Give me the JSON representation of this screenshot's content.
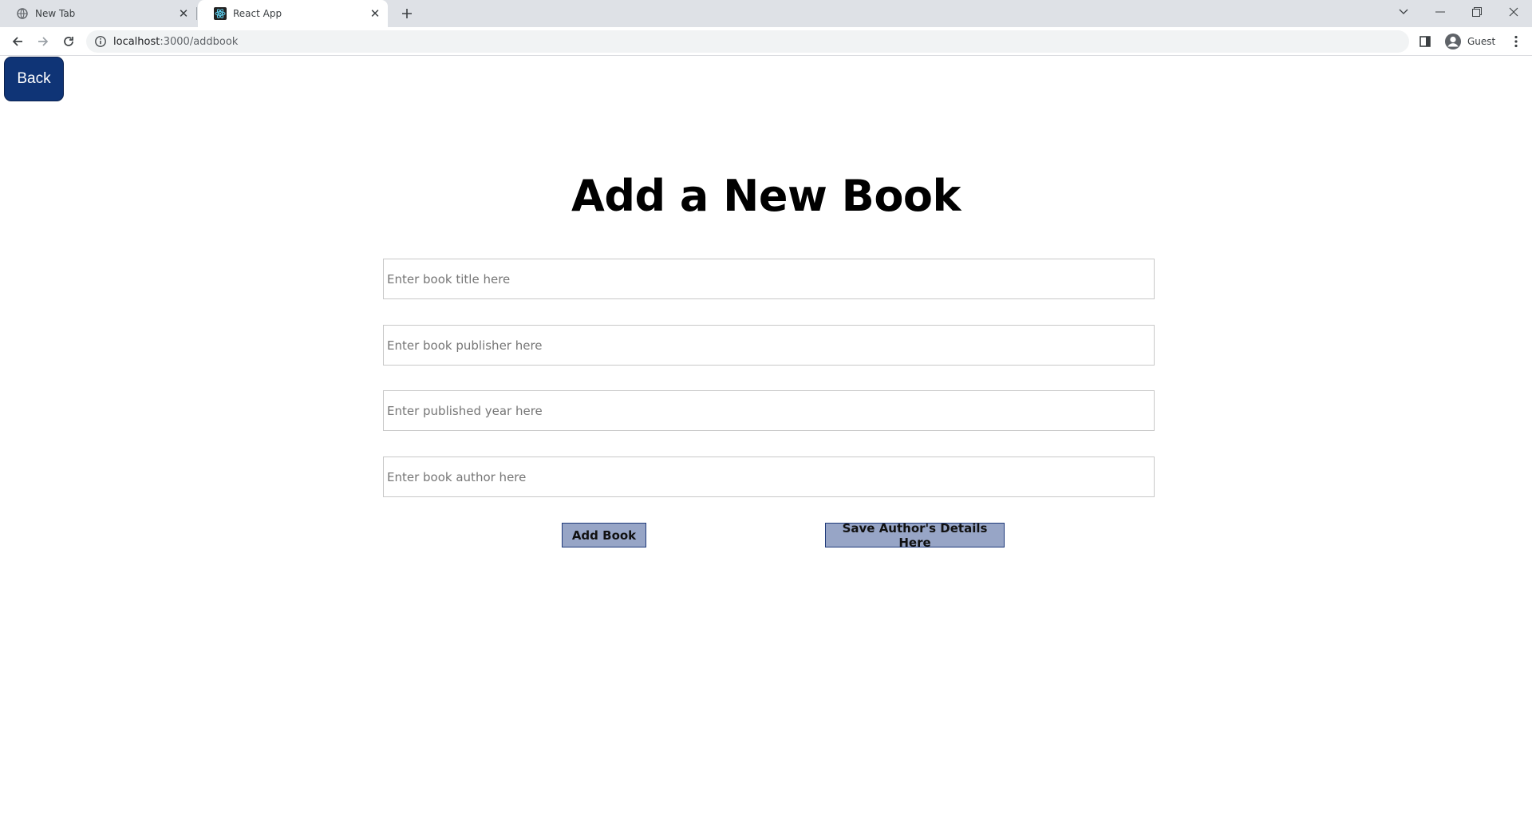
{
  "browser": {
    "tabs": [
      {
        "title": "New Tab",
        "active": false,
        "icon": "globe-icon"
      },
      {
        "title": "React App",
        "active": true,
        "icon": "react-icon"
      }
    ],
    "address": {
      "host": "localhost",
      "path": ":3000/addbook"
    },
    "profile_label": "Guest"
  },
  "page": {
    "back_label": "Back",
    "title": "Add a New Book",
    "fields": {
      "title_placeholder": "Enter book title here",
      "publisher_placeholder": "Enter book publisher here",
      "year_placeholder": "Enter published year here",
      "author_placeholder": "Enter book author here"
    },
    "add_book_label": "Add Book",
    "save_author_label": "Save Author's Details Here"
  },
  "colors": {
    "back_button_bg": "#0f3476",
    "action_button_bg": "#97a5c6",
    "tabstrip_bg": "#dee1e6"
  }
}
